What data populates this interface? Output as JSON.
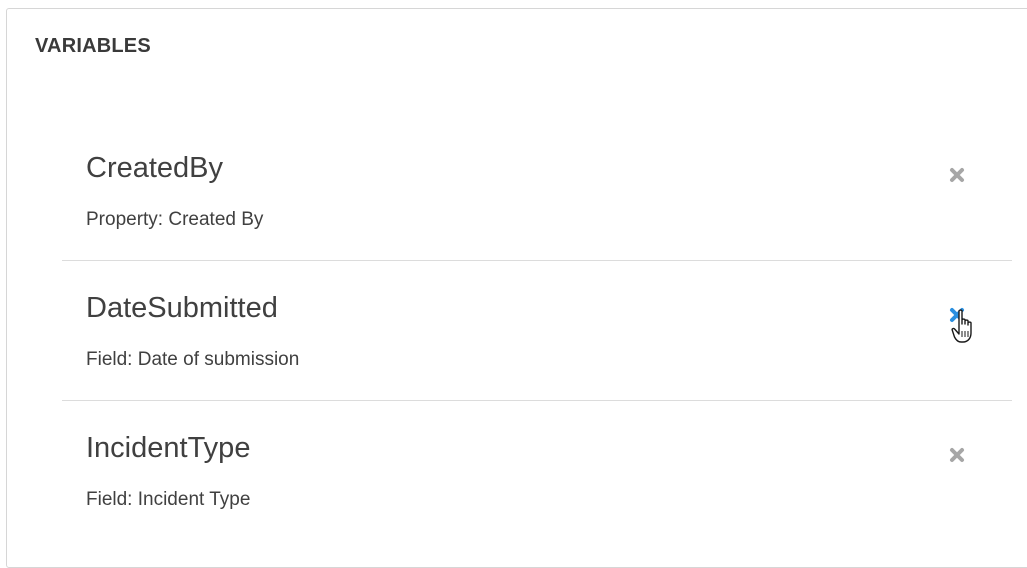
{
  "panel": {
    "title": "VARIABLES"
  },
  "variables": [
    {
      "name": "CreatedBy",
      "source": "Property: Created By",
      "remove_icon": "close-icon",
      "hovered": false
    },
    {
      "name": "DateSubmitted",
      "source": "Field: Date of submission",
      "remove_icon": "close-icon",
      "hovered": true
    },
    {
      "name": "IncidentType",
      "source": "Field: Incident Type",
      "remove_icon": "close-icon",
      "hovered": false
    }
  ],
  "colors": {
    "remove_icon_default": "#a6a6a6",
    "remove_icon_hover": "#2a8fe0",
    "divider": "#dcdcdc",
    "text": "#404040"
  },
  "cursor": "hand-pointer-cursor"
}
